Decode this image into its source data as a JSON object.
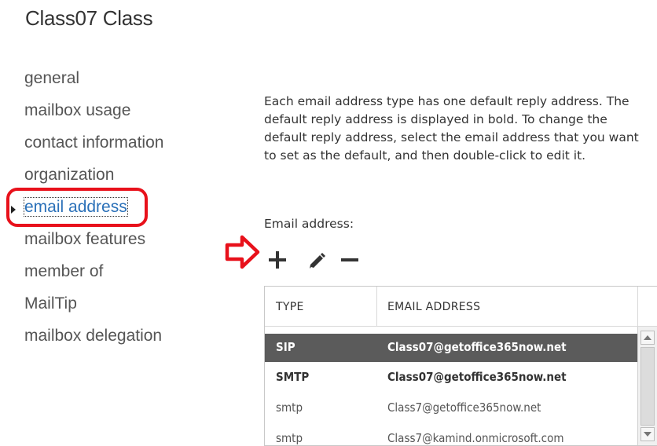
{
  "window": {
    "title": "Class07 Class"
  },
  "nav": {
    "items": [
      {
        "label": "general"
      },
      {
        "label": "mailbox usage"
      },
      {
        "label": "contact information"
      },
      {
        "label": "organization"
      },
      {
        "label": "email address",
        "selected": true
      },
      {
        "label": "mailbox features"
      },
      {
        "label": "member of"
      },
      {
        "label": "MailTip"
      },
      {
        "label": "mailbox delegation"
      }
    ]
  },
  "main": {
    "description": "Each email address type has one default reply address. The default reply address is displayed in bold. To change the default reply address, select the email address that you want to set as the default, and then double-click to edit it.",
    "email_label": "Email address:",
    "toolbar": {
      "add_icon": "plus-icon",
      "edit_icon": "pencil-icon",
      "remove_icon": "minus-icon"
    },
    "table": {
      "headers": [
        "TYPE",
        "EMAIL ADDRESS"
      ],
      "rows": [
        {
          "type": "SIP",
          "address": "Class07@getoffice365now.net",
          "selected": true,
          "default": true
        },
        {
          "type": "SMTP",
          "address": "Class07@getoffice365now.net",
          "default": true
        },
        {
          "type": "smtp",
          "address": "Class7@getoffice365now.net"
        },
        {
          "type": "smtp",
          "address": "Class7@kamind.onmicrosoft.com"
        }
      ]
    }
  },
  "annotation_colors": {
    "highlight": "#e8111b",
    "selection_link": "#2a70b8",
    "selected_row_bg": "#5b5b5b"
  }
}
